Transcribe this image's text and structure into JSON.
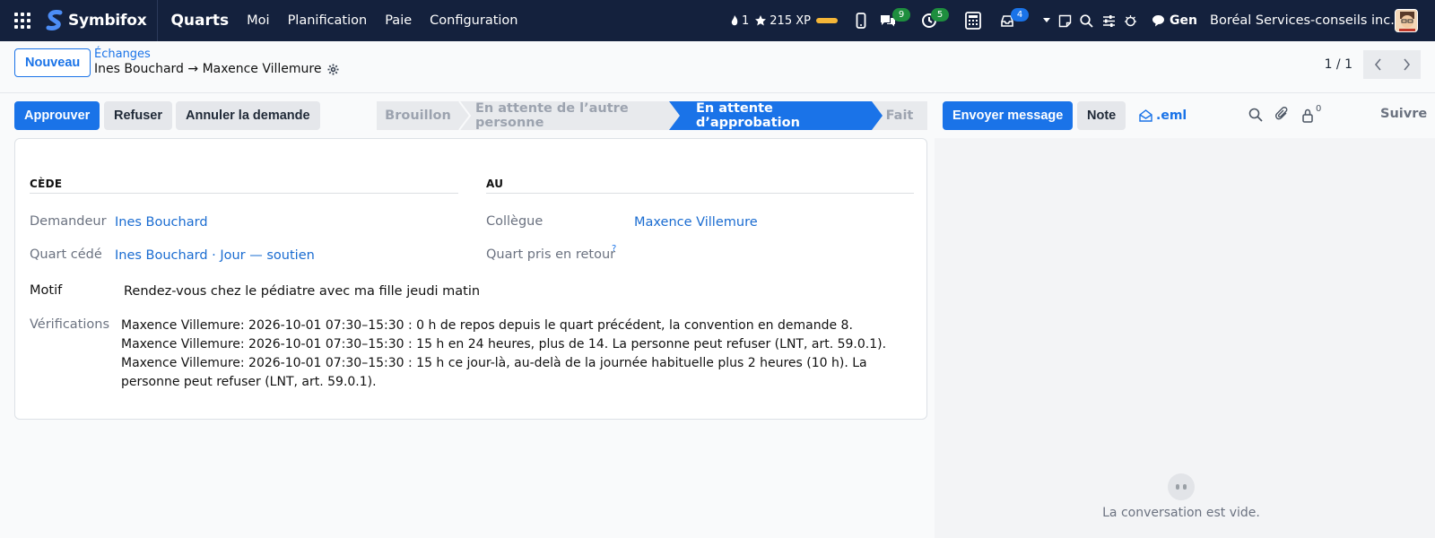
{
  "navbar": {
    "brand": "Symbifox",
    "app_title": "Quarts",
    "menu": [
      "Moi",
      "Planification",
      "Paie",
      "Configuration"
    ],
    "streak": "1",
    "xp": "215 XP",
    "messages_count": "9",
    "activities_count": "5",
    "inbox_count": "4",
    "ai_label": "Gen",
    "company": "Boréal Services-conseils inc."
  },
  "control": {
    "new_button": "Nouveau",
    "breadcrumb_parent": "Échanges",
    "record_title": "Ines Bouchard → Maxence Villemure",
    "pager": "1 / 1"
  },
  "actions": {
    "approve": "Approuver",
    "refuse": "Refuser",
    "cancel": "Annuler la demande"
  },
  "stages": [
    {
      "label": "Brouillon",
      "active": false
    },
    {
      "label": "En attente de l’autre personne",
      "active": false
    },
    {
      "label": "En attente d’approbation",
      "active": true
    },
    {
      "label": "Fait",
      "active": false
    }
  ],
  "form": {
    "section_left": "CÈDE",
    "section_right": "AU",
    "requester_label": "Demandeur",
    "requester_value": "Ines Bouchard",
    "shift_given_label": "Quart cédé",
    "shift_given_value": "Ines Bouchard · Jour — soutien",
    "colleague_label": "Collègue",
    "colleague_value": "Maxence Villemure",
    "shift_taken_label": "Quart pris en retour",
    "help_mark": "?",
    "reason_label": "Motif",
    "reason_value": "Rendez-vous chez le pédiatre avec ma fille jeudi matin",
    "checks_label": "Vérifications",
    "checks": [
      "Maxence Villemure: 2026-10-01 07:30–15:30 : 0 h de repos depuis le quart précédent, la convention en demande 8.",
      "Maxence Villemure: 2026-10-01 07:30–15:30 : 15 h en 24 heures, plus de 14. La personne peut refuser (LNT, art. 59.0.1).",
      "Maxence Villemure: 2026-10-01 07:30–15:30 : 15 h ce jour-là, au-delà de la journée habituelle plus 2 heures (10 h). La personne peut refuser (LNT, art. 59.0.1)."
    ]
  },
  "chatter": {
    "send_message": "Envoyer message",
    "note": "Note",
    "eml": ".eml",
    "followers_count": "0",
    "follow": "Suivre",
    "empty_text": "La conversation est vide."
  },
  "colors": {
    "navbar": "#14213d",
    "primary": "#1a73e8",
    "link": "#1a6cd1"
  }
}
